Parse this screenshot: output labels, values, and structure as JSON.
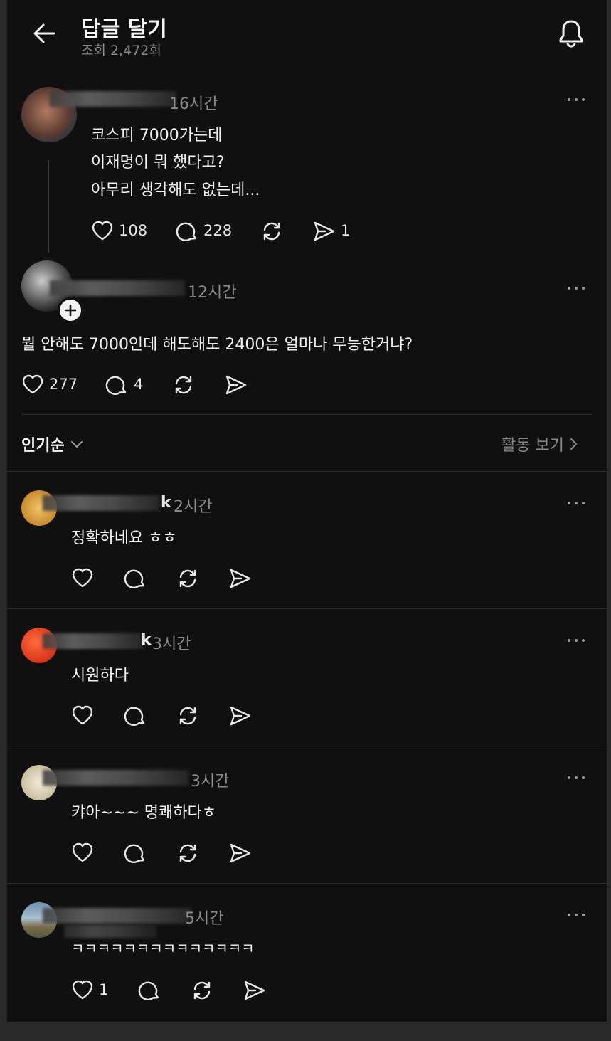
{
  "header": {
    "title": "답글 달기",
    "views": "조회 2,472회"
  },
  "original_post": {
    "time": "16시간",
    "lines": [
      "코스피 7000가는데",
      "이재명이 뭐 했다고?",
      "아무리 생각해도 없는데..."
    ],
    "likes": "108",
    "comments": "228",
    "shares": "1"
  },
  "reply_post": {
    "time": "12시간",
    "text": "뭘 안해도 7000인데 해도해도 2400은 얼마나 무능한거냐?",
    "likes": "277",
    "comments": "4"
  },
  "sort_bar": {
    "sort_label": "인기순",
    "activity_label": "활동 보기"
  },
  "comments": [
    {
      "name_fragment": "k",
      "time": "2시간",
      "text": "정확하네요 ㅎㅎ",
      "likes": ""
    },
    {
      "name_fragment": "k",
      "time": "3시간",
      "text": "시원하다",
      "likes": ""
    },
    {
      "name_fragment": "",
      "time": "3시간",
      "text": "캬아~~~ 명쾌하다ㅎ",
      "likes": ""
    },
    {
      "name_fragment": "",
      "time": "5시간",
      "text": "ㅋㅋㅋㅋㅋㅋㅋㅋㅋㅋㅋㅋㅋㅋ",
      "likes": "1"
    }
  ],
  "icons": {
    "back": "arrow-left-icon",
    "notify": "bell-icon",
    "more": "more-horizontal-icon",
    "like": "heart-icon",
    "comment": "comment-bubble-icon",
    "repost": "repost-icon",
    "share": "send-icon",
    "chevron": "chevron-down-icon"
  }
}
